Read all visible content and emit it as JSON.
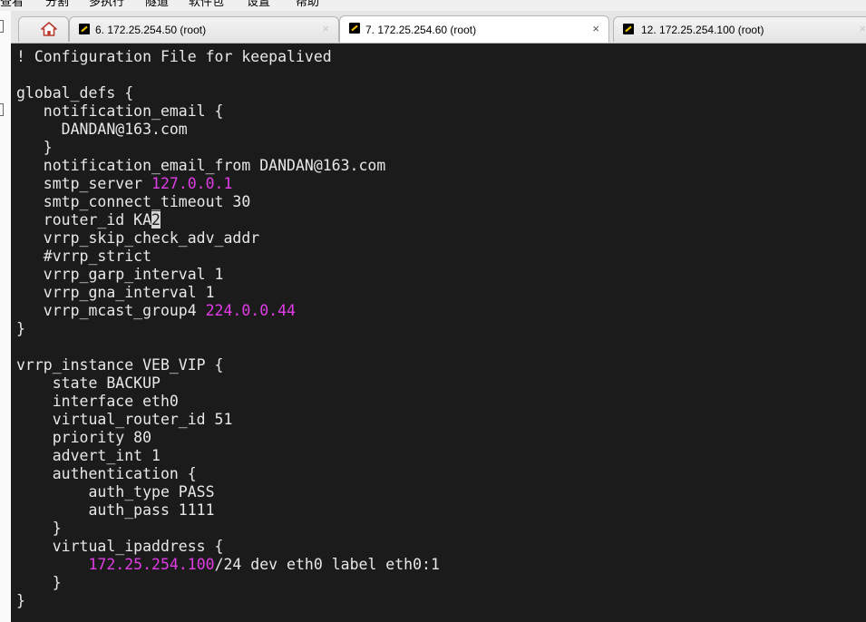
{
  "menu": {
    "items": [
      "查看",
      "分割",
      "多执行",
      "隧道",
      "软件包",
      "设置",
      "帮助"
    ]
  },
  "tabs": [
    {
      "kind": "home",
      "label": ""
    },
    {
      "kind": "session",
      "label": "6. 172.25.254.50 (root)",
      "close": "×"
    },
    {
      "kind": "session",
      "label": "7. 172.25.254.60 (root)",
      "close": "×",
      "active": true
    },
    {
      "kind": "session",
      "label": "12. 172.25.254.100 (root)",
      "close": "×"
    }
  ],
  "terminal": {
    "colors": {
      "background": "#1b1b1b",
      "text": "#e8e8e8",
      "ip_highlight": "#e13ce6"
    },
    "lines": [
      [
        {
          "t": "! Configuration File for keepalived"
        }
      ],
      [
        {
          "t": ""
        }
      ],
      [
        {
          "t": "global_defs {"
        }
      ],
      [
        {
          "t": "   notification_email {"
        }
      ],
      [
        {
          "t": "     DANDAN@163.com"
        }
      ],
      [
        {
          "t": "   }"
        }
      ],
      [
        {
          "t": "   notification_email_from DANDAN@163.com"
        }
      ],
      [
        {
          "t": "   smtp_server "
        },
        {
          "t": "127.0.0.1",
          "c": "ip"
        }
      ],
      [
        {
          "t": "   smtp_connect_timeout 30"
        }
      ],
      [
        {
          "t": "   router_id KA"
        },
        {
          "t": "2",
          "c": "cursor"
        }
      ],
      [
        {
          "t": "   vrrp_skip_check_adv_addr"
        }
      ],
      [
        {
          "t": "   #vrrp_strict"
        }
      ],
      [
        {
          "t": "   vrrp_garp_interval 1"
        }
      ],
      [
        {
          "t": "   vrrp_gna_interval 1"
        }
      ],
      [
        {
          "t": "   vrrp_mcast_group4 "
        },
        {
          "t": "224.0.0.44",
          "c": "ip"
        }
      ],
      [
        {
          "t": "}"
        }
      ],
      [
        {
          "t": ""
        }
      ],
      [
        {
          "t": "vrrp_instance VEB_VIP {"
        }
      ],
      [
        {
          "t": "    state BACKUP"
        }
      ],
      [
        {
          "t": "    interface eth0"
        }
      ],
      [
        {
          "t": "    virtual_router_id 51"
        }
      ],
      [
        {
          "t": "    priority 80"
        }
      ],
      [
        {
          "t": "    advert_int 1"
        }
      ],
      [
        {
          "t": "    authentication {"
        }
      ],
      [
        {
          "t": "        auth_type PASS"
        }
      ],
      [
        {
          "t": "        auth_pass 1111"
        }
      ],
      [
        {
          "t": "    }"
        }
      ],
      [
        {
          "t": "    virtual_ipaddress {"
        }
      ],
      [
        {
          "t": "        "
        },
        {
          "t": "172.25.254.100",
          "c": "ip"
        },
        {
          "t": "/24 dev eth0 label eth0:1"
        }
      ],
      [
        {
          "t": "    }"
        }
      ],
      [
        {
          "t": "}"
        }
      ]
    ]
  }
}
